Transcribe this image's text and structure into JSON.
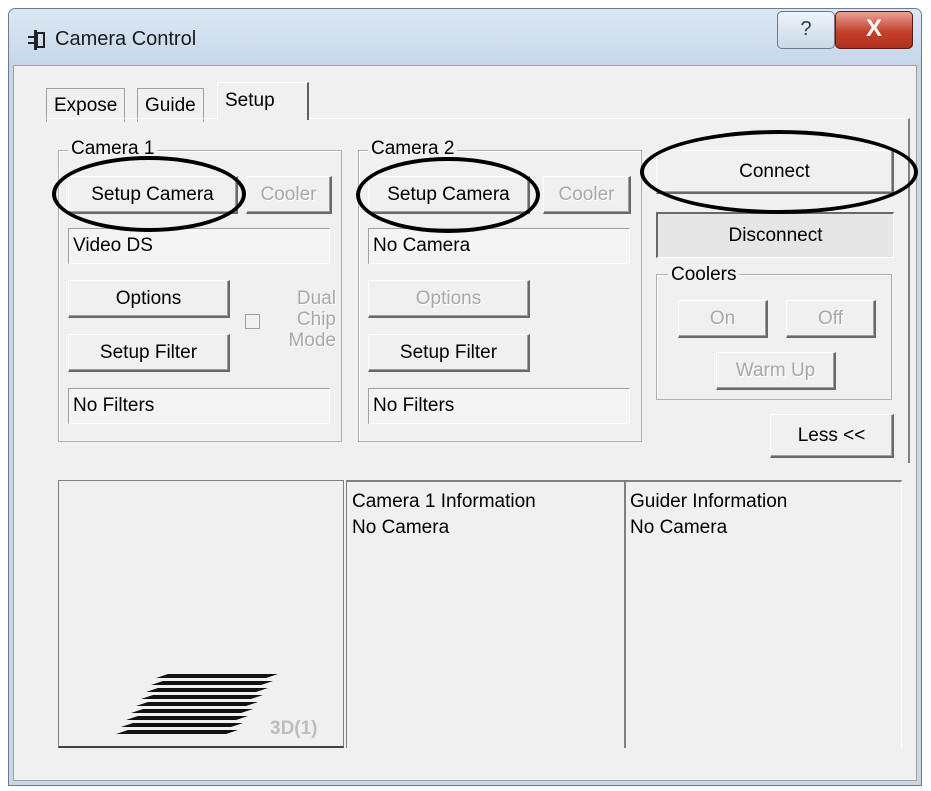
{
  "window": {
    "title": "Camera Control",
    "help_label": "?",
    "close_label": "X"
  },
  "tabs": [
    {
      "label": "Expose",
      "active": false
    },
    {
      "label": "Guide",
      "active": false
    },
    {
      "label": "Setup",
      "active": true
    }
  ],
  "camera1": {
    "group_label": "Camera 1",
    "setup_camera_label": "Setup Camera",
    "cooler_label": "Cooler",
    "camera_value": "Video DS",
    "options_label": "Options",
    "dual_chip_label": "Dual\nChip\nMode",
    "setup_filter_label": "Setup Filter",
    "filter_value": "No Filters"
  },
  "camera2": {
    "group_label": "Camera 2",
    "setup_camera_label": "Setup Camera",
    "cooler_label": "Cooler",
    "camera_value": "No Camera",
    "options_label": "Options",
    "setup_filter_label": "Setup Filter",
    "filter_value": "No Filters"
  },
  "connection": {
    "connect_label": "Connect",
    "disconnect_label": "Disconnect"
  },
  "coolers": {
    "group_label": "Coolers",
    "on_label": "On",
    "off_label": "Off",
    "warm_up_label": "Warm Up"
  },
  "less_label": "Less <<",
  "thumbnail": {
    "label": "3D(1)"
  },
  "info": {
    "camera1_title": "Camera 1 Information",
    "camera1_status": "No Camera",
    "guider_title": "Guider Information",
    "guider_status": "No Camera"
  },
  "colors": {
    "titlebar": "#c8d6e6",
    "client_bg": "#f0f0f0",
    "close_button": "#c4412c",
    "annotation_ellipse": "#000000"
  },
  "icons": {
    "app": "camera-control-icon",
    "help": "help-icon",
    "close": "close-icon",
    "thumbnail": "3d-stripes-icon"
  }
}
